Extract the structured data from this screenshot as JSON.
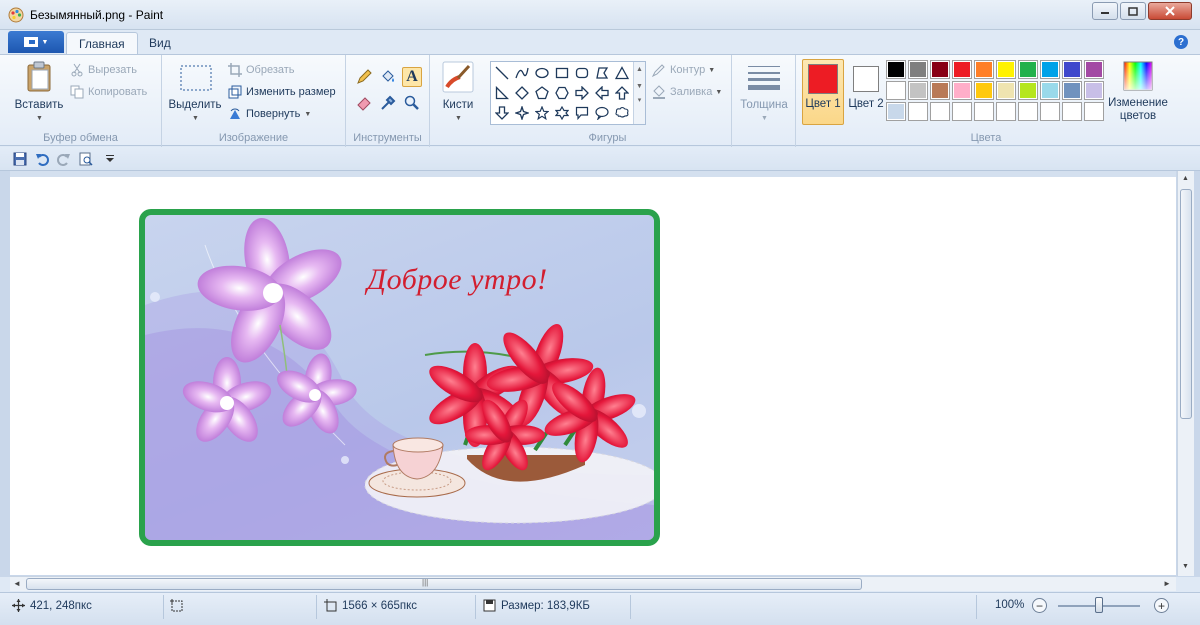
{
  "window": {
    "title": "Безымянный.png - Paint"
  },
  "tabs": {
    "home": "Главная",
    "view": "Вид"
  },
  "clipboard": {
    "paste": "Вставить",
    "cut": "Вырезать",
    "copy": "Копировать",
    "group": "Буфер обмена"
  },
  "image": {
    "select": "Выделить",
    "crop": "Обрезать",
    "resize": "Изменить размер",
    "rotate": "Повернуть",
    "group": "Изображение"
  },
  "tools": {
    "group": "Инструменты"
  },
  "brushes": {
    "label": "Кисти"
  },
  "shapes": {
    "outline": "Контур",
    "fill": "Заливка",
    "group": "Фигуры"
  },
  "size": {
    "label": "Толщина"
  },
  "colors": {
    "color1_label": "Цвет 1",
    "color2_label": "Цвет 2",
    "edit": "Изменение цветов",
    "group": "Цвета",
    "color1": "#ed1c24",
    "color2": "#ffffff",
    "palette": [
      [
        "#000000",
        "#7f7f7f",
        "#880015",
        "#ed1c24",
        "#ff7f27",
        "#fff200",
        "#22b14c",
        "#00a2e8",
        "#3f48cc",
        "#a349a4"
      ],
      [
        "#ffffff",
        "#c3c3c3",
        "#b97a57",
        "#ffaec9",
        "#ffc90e",
        "#efe4b0",
        "#b5e61d",
        "#99d9ea",
        "#7092be",
        "#c8bfe7"
      ],
      [
        "#c8d8ea",
        "#ffffff",
        "#ffffff",
        "#ffffff",
        "#ffffff",
        "#ffffff",
        "#ffffff",
        "#ffffff",
        "#ffffff",
        "#ffffff"
      ]
    ]
  },
  "canvas": {
    "greeting": "Доброе утро!",
    "frame_color": "#2aa24c",
    "text_color": "#d21e2f"
  },
  "status": {
    "cursor": "421, 248пкс",
    "dimensions": "1566 × 665пкс",
    "filesize": "Размер: 183,9КБ",
    "zoom": "100%"
  }
}
